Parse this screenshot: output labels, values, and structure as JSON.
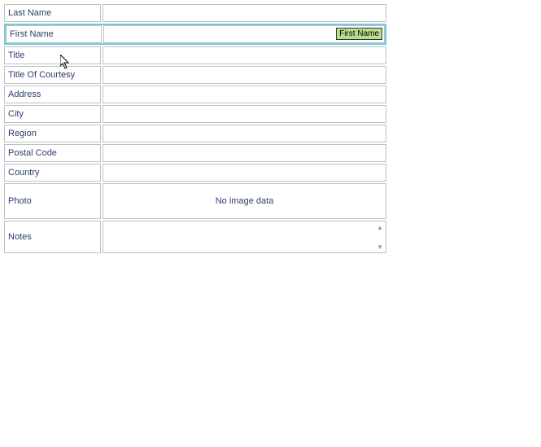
{
  "form": {
    "lastName": {
      "label": "Last Name",
      "value": ""
    },
    "firstName": {
      "label": "First Name",
      "value": "",
      "tooltip": "First Name"
    },
    "title": {
      "label": "Title",
      "value": ""
    },
    "titleOfCourtesy": {
      "label": "Title Of Courtesy",
      "value": ""
    },
    "address": {
      "label": "Address",
      "value": ""
    },
    "city": {
      "label": "City",
      "value": ""
    },
    "region": {
      "label": "Region",
      "value": ""
    },
    "postalCode": {
      "label": "Postal Code",
      "value": ""
    },
    "country": {
      "label": "Country",
      "value": ""
    },
    "photo": {
      "label": "Photo",
      "placeholder": "No image data"
    },
    "notes": {
      "label": "Notes",
      "value": ""
    }
  }
}
